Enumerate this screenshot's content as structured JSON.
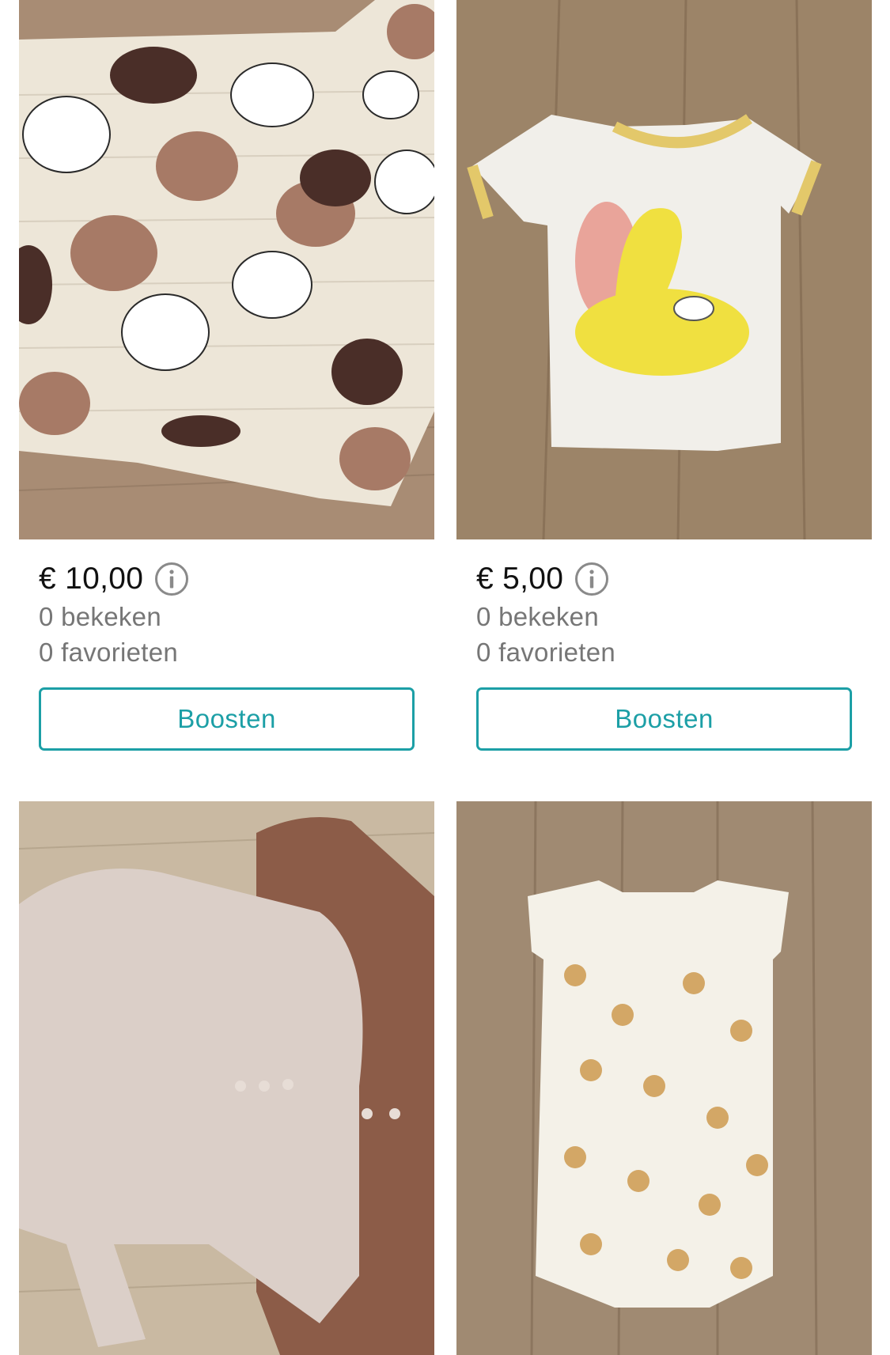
{
  "items": [
    {
      "price": "€ 10,00",
      "views": "0 bekeken",
      "favorites": "0 favorieten",
      "boost_label": "Boosten"
    },
    {
      "price": "€ 5,00",
      "views": "0 bekeken",
      "favorites": "0 favorieten",
      "boost_label": "Boosten"
    },
    {},
    {}
  ],
  "colors": {
    "accent": "#1c9fa6",
    "muted_text": "#767676",
    "price_text": "#111111"
  },
  "icons": {
    "info": "info-circle-icon"
  }
}
